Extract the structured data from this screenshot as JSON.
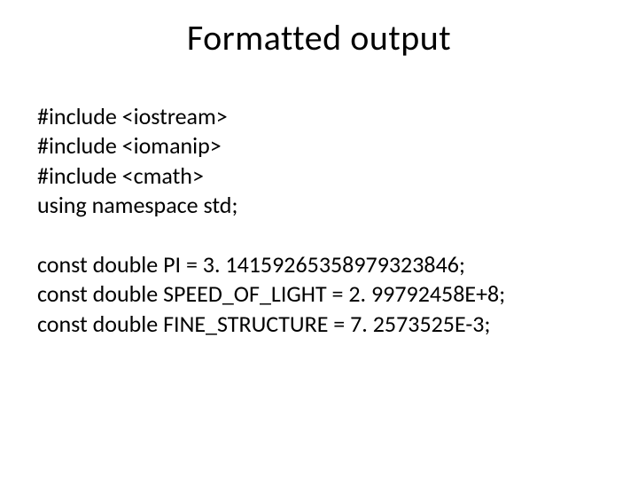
{
  "title": "Formatted output",
  "code": {
    "includes": [
      "#include <iostream>",
      "#include <iomanip>",
      "#include <cmath>",
      "using namespace std;"
    ],
    "constants": [
      "const double PI = 3. 14159265358979323846;",
      "const double SPEED_OF_LIGHT = 2. 99792458E+8;",
      "const double FINE_STRUCTURE = 7. 2573525E-3;"
    ]
  }
}
